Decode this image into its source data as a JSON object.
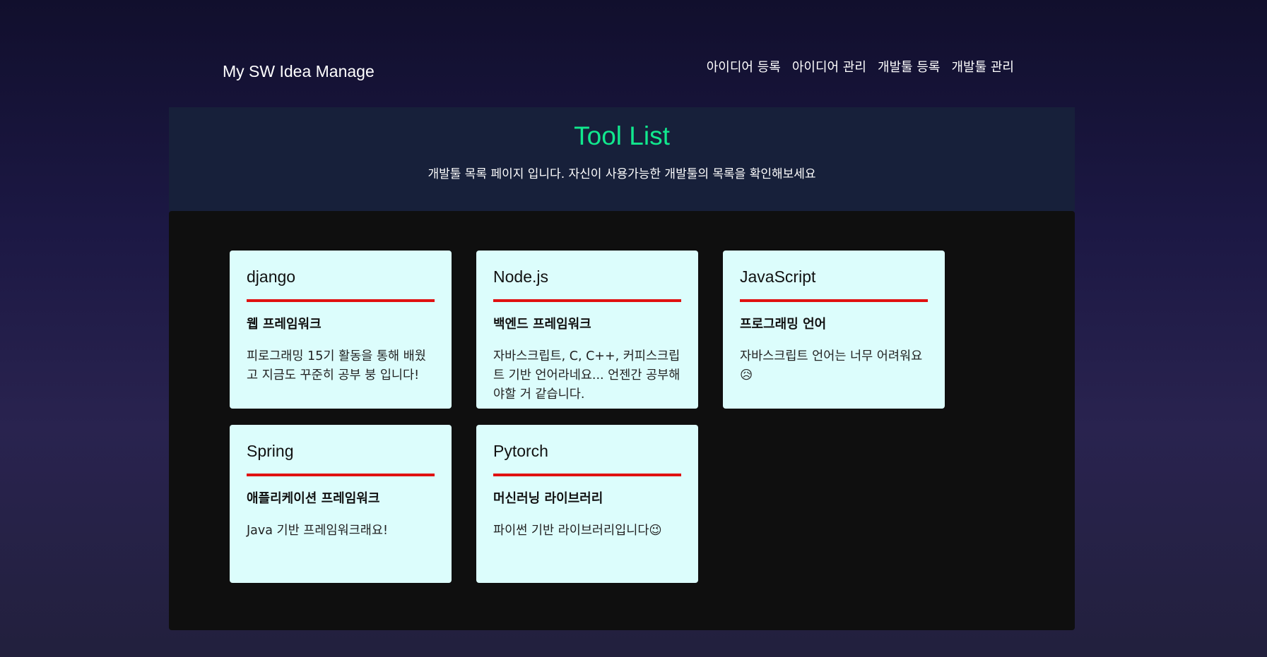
{
  "header": {
    "brand": "My SW Idea Manage",
    "nav": [
      {
        "label": "아이디어 등록"
      },
      {
        "label": "아이디어 관리"
      },
      {
        "label": "개발툴 등록"
      },
      {
        "label": "개발툴 관리"
      }
    ]
  },
  "hero": {
    "title": "Tool List",
    "subtitle": "개발툴 목록 페이지 입니다. 자신이 사용가능한 개발툴의 목록을 확인해보세요"
  },
  "tools": [
    {
      "name": "django",
      "category": "웹 프레임워크",
      "description": "피로그래밍 15기 활동을 통해 배웠고 지금도 꾸준히 공부 붕 입니다!"
    },
    {
      "name": "Node.js",
      "category": "백엔드 프레임워크",
      "description": "자바스크립트, C, C++, 커피스크립트 기반 언어라네요... 언젠간 공부해야할 거 같습니다."
    },
    {
      "name": "JavaScript",
      "category": "프로그래밍 언어",
      "description": "자바스크립트 언어는 너무 어려워요😥"
    },
    {
      "name": "Spring",
      "category": "애플리케이션 프레임워크",
      "description": "Java 기반 프레임워크래요!"
    },
    {
      "name": "Pytorch",
      "category": "머신러닝 라이브러리",
      "description": "파이썬 기반 라이브러리입니다😉"
    }
  ],
  "colors": {
    "accent": "#11e88e",
    "divider": "#e01111",
    "card_background": "#dcfdfc",
    "hero_background": "#17203a",
    "panel_background": "#0f0f0f"
  }
}
